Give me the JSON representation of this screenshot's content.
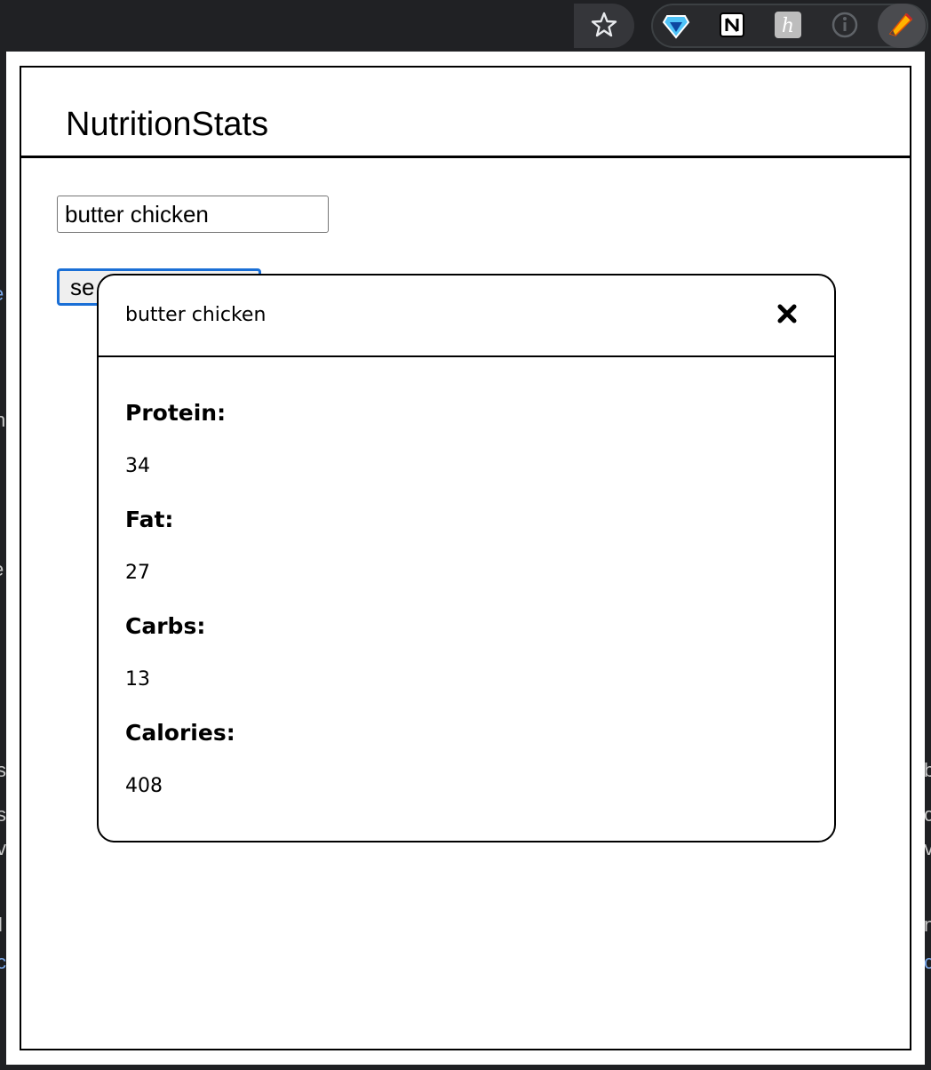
{
  "browser": {
    "icons": [
      "star-icon",
      "gem-extension-icon",
      "notion-icon",
      "h-extension-icon",
      "info-extension-icon",
      "pencil-extension-icon"
    ]
  },
  "app": {
    "title": "NutritionStats",
    "search_value": "butter chicken",
    "search_button_label": "se"
  },
  "modal": {
    "title": "butter chicken",
    "close_label": "✖",
    "stats": [
      {
        "label": "Protein:",
        "value": "34"
      },
      {
        "label": "Fat:",
        "value": "27"
      },
      {
        "label": "Carbs:",
        "value": "13"
      },
      {
        "label": "Calories:",
        "value": "408"
      }
    ]
  },
  "colors": {
    "accent": "#1a6fd6",
    "chrome_bg": "#202124"
  }
}
